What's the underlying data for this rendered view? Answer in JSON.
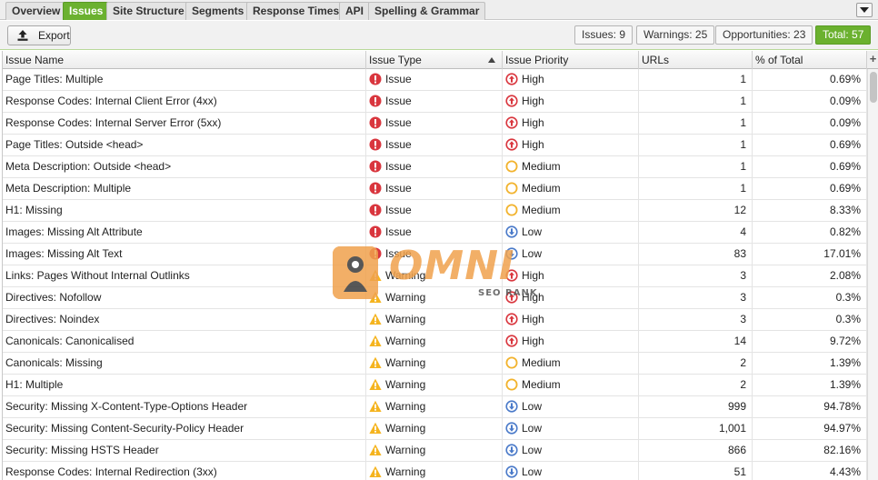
{
  "tabs": [
    {
      "label": "Overview",
      "active": false
    },
    {
      "label": "Issues",
      "active": true
    },
    {
      "label": "Site Structure",
      "active": false
    },
    {
      "label": "Segments",
      "active": false
    },
    {
      "label": "Response Times",
      "active": false
    },
    {
      "label": "API",
      "active": false
    },
    {
      "label": "Spelling & Grammar",
      "active": false
    }
  ],
  "toolbar": {
    "export_label": "Export",
    "chips": {
      "issues": "Issues: 9",
      "warnings": "Warnings: 25",
      "opportunities": "Opportunities: 23",
      "total": "Total: 57"
    }
  },
  "table": {
    "columns": [
      "Issue Name",
      "Issue Type",
      "Issue Priority",
      "URLs",
      "% of Total"
    ],
    "add_column_label": "+",
    "rows": [
      {
        "name": "Page Titles: Multiple",
        "type": "Issue",
        "priority": "High",
        "urls": "1",
        "pct": "0.69%"
      },
      {
        "name": "Response Codes: Internal Client Error (4xx)",
        "type": "Issue",
        "priority": "High",
        "urls": "1",
        "pct": "0.09%"
      },
      {
        "name": "Response Codes: Internal Server Error (5xx)",
        "type": "Issue",
        "priority": "High",
        "urls": "1",
        "pct": "0.09%"
      },
      {
        "name": "Page Titles: Outside <head>",
        "type": "Issue",
        "priority": "High",
        "urls": "1",
        "pct": "0.69%"
      },
      {
        "name": "Meta Description: Outside <head>",
        "type": "Issue",
        "priority": "Medium",
        "urls": "1",
        "pct": "0.69%"
      },
      {
        "name": "Meta Description: Multiple",
        "type": "Issue",
        "priority": "Medium",
        "urls": "1",
        "pct": "0.69%"
      },
      {
        "name": "H1: Missing",
        "type": "Issue",
        "priority": "Medium",
        "urls": "12",
        "pct": "8.33%"
      },
      {
        "name": "Images: Missing Alt Attribute",
        "type": "Issue",
        "priority": "Low",
        "urls": "4",
        "pct": "0.82%"
      },
      {
        "name": "Images: Missing Alt Text",
        "type": "Issue",
        "priority": "Low",
        "urls": "83",
        "pct": "17.01%"
      },
      {
        "name": "Links: Pages Without Internal Outlinks",
        "type": "Warning",
        "priority": "High",
        "urls": "3",
        "pct": "2.08%"
      },
      {
        "name": "Directives: Nofollow",
        "type": "Warning",
        "priority": "High",
        "urls": "3",
        "pct": "0.3%"
      },
      {
        "name": "Directives: Noindex",
        "type": "Warning",
        "priority": "High",
        "urls": "3",
        "pct": "0.3%"
      },
      {
        "name": "Canonicals: Canonicalised",
        "type": "Warning",
        "priority": "High",
        "urls": "14",
        "pct": "9.72%"
      },
      {
        "name": "Canonicals: Missing",
        "type": "Warning",
        "priority": "Medium",
        "urls": "2",
        "pct": "1.39%"
      },
      {
        "name": "H1: Multiple",
        "type": "Warning",
        "priority": "Medium",
        "urls": "2",
        "pct": "1.39%"
      },
      {
        "name": "Security: Missing X-Content-Type-Options Header",
        "type": "Warning",
        "priority": "Low",
        "urls": "999",
        "pct": "94.78%"
      },
      {
        "name": "Security: Missing Content-Security-Policy Header",
        "type": "Warning",
        "priority": "Low",
        "urls": "1,001",
        "pct": "94.97%"
      },
      {
        "name": "Security: Missing HSTS Header",
        "type": "Warning",
        "priority": "Low",
        "urls": "866",
        "pct": "82.16%"
      },
      {
        "name": "Response Codes: Internal Redirection (3xx)",
        "type": "Warning",
        "priority": "Low",
        "urls": "51",
        "pct": "4.43%"
      }
    ]
  },
  "watermark": {
    "logo_text": "OMNI",
    "logo_sub": "SEO RANK"
  },
  "icons": {
    "export": "upload-icon",
    "issue": "error-circle-icon",
    "warning": "warning-triangle-icon",
    "high": "arrow-up-circle-icon",
    "medium": "circle-outline-icon",
    "low": "arrow-down-circle-icon",
    "menu": "chevron-down-icon"
  },
  "colors": {
    "accent_green": "#6bb12f",
    "issue_red": "#d9363e",
    "warning_yellow": "#f5b41f",
    "priority_high": "#d9363e",
    "priority_medium": "#f2b32d",
    "priority_low": "#4a7ac9"
  }
}
